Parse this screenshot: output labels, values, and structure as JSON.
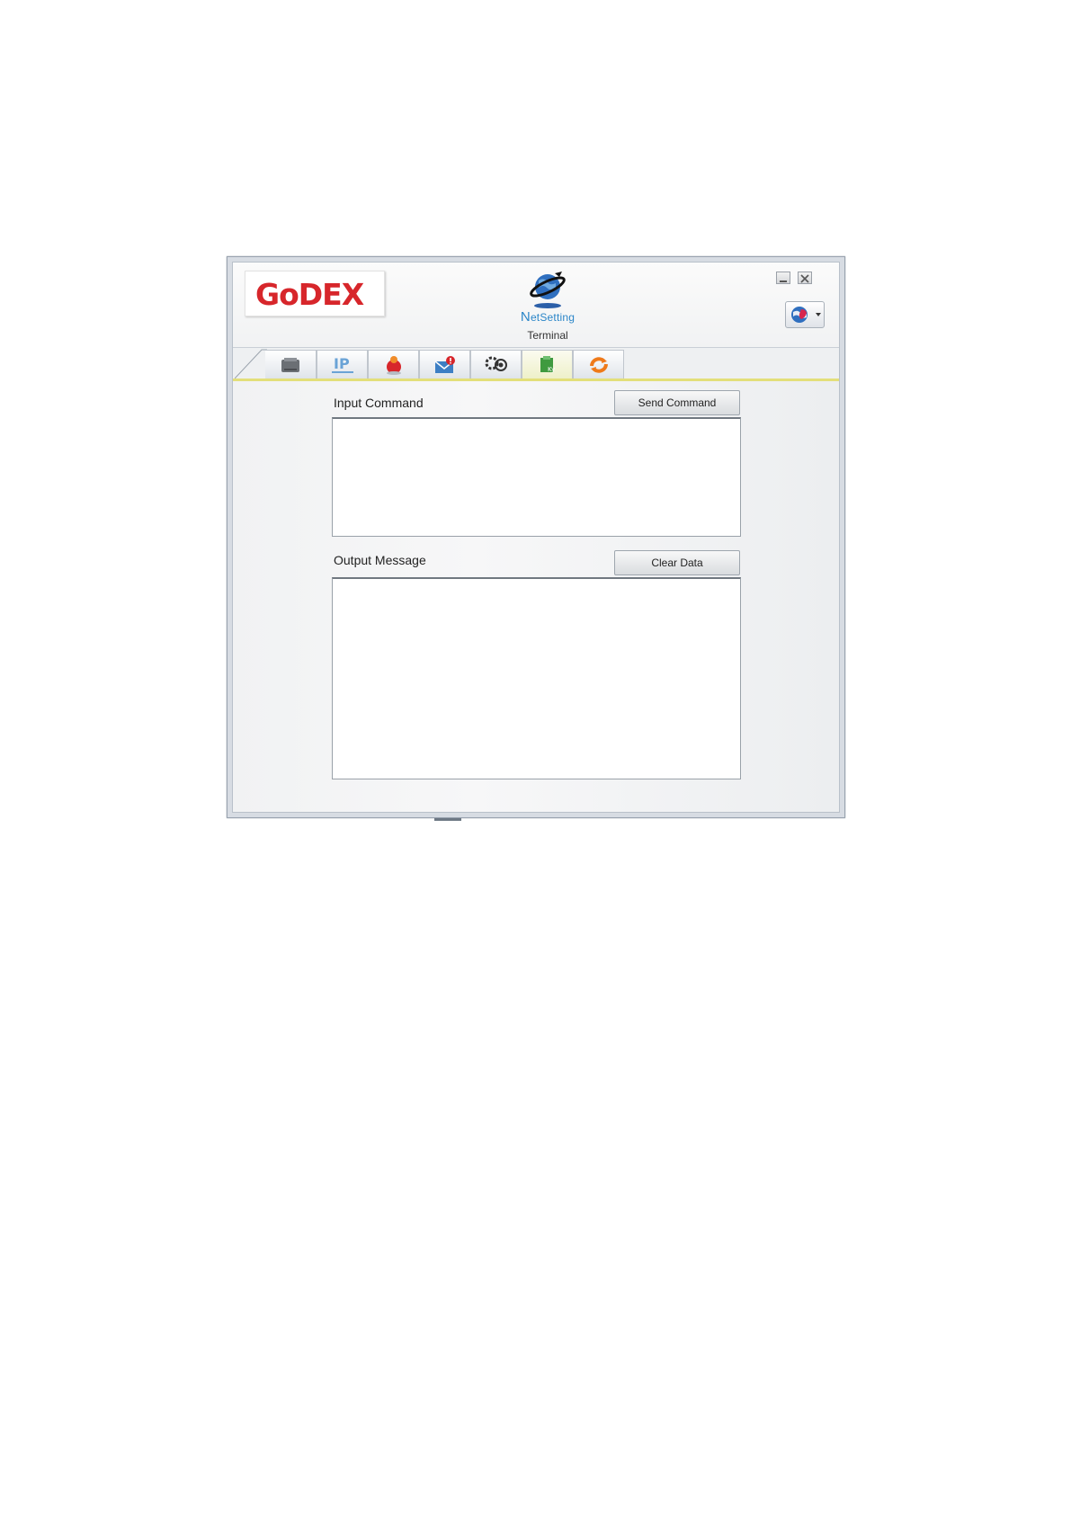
{
  "logo": {
    "text": "GoDEX"
  },
  "app": {
    "name_first": "N",
    "name_rest": "etSetting",
    "page_label": "Terminal"
  },
  "window_controls": [
    "minimize",
    "close"
  ],
  "language_button": {
    "icon": "language-globe-icon"
  },
  "tabs": [
    {
      "icon": "printer-icon",
      "active": false
    },
    {
      "icon": "ip-network-icon",
      "active": false
    },
    {
      "icon": "alert-ball-icon",
      "active": false
    },
    {
      "icon": "mail-alert-icon",
      "active": false
    },
    {
      "icon": "settings-gears-icon",
      "active": false
    },
    {
      "icon": "terminal-key-icon",
      "active": true
    },
    {
      "icon": "refresh-icon",
      "active": false
    }
  ],
  "input_section": {
    "label": "Input Command",
    "button_label": "Send Command",
    "value": ""
  },
  "output_section": {
    "label": "Output Message",
    "button_label": "Clear Data",
    "value": ""
  },
  "colors": {
    "brand_red": "#d7262b",
    "accent_blue": "#2b86c8",
    "tab_underline": "#e3df7a"
  }
}
